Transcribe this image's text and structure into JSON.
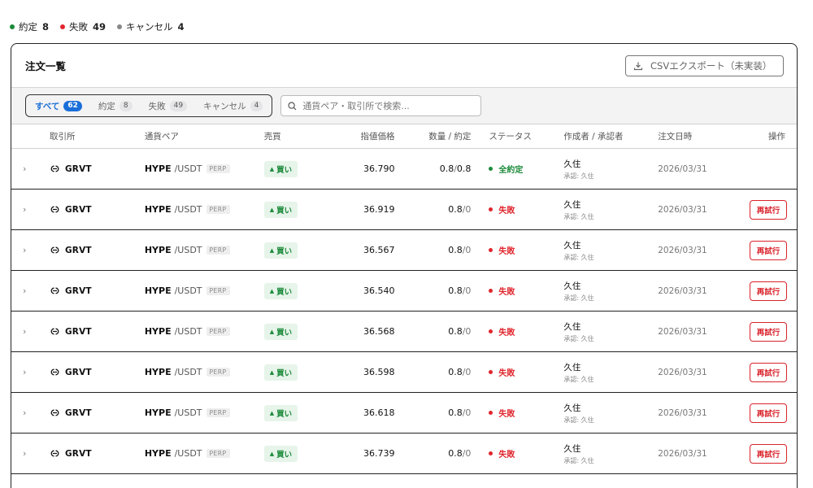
{
  "summary": {
    "filled": {
      "label": "約定",
      "count": "8",
      "color": "#1b8a3a"
    },
    "failed": {
      "label": "失敗",
      "count": "49",
      "color": "#e0262d"
    },
    "canceled": {
      "label": "キャンセル",
      "count": "4",
      "color": "#888888"
    }
  },
  "panel": {
    "title": "注文一覧",
    "export_label": "CSVエクスポート（未実装）",
    "export_icon": "download-icon"
  },
  "filters": {
    "tabs": [
      {
        "label": "すべて",
        "count": "62",
        "active": true
      },
      {
        "label": "約定",
        "count": "8",
        "active": false
      },
      {
        "label": "失敗",
        "count": "49",
        "active": false
      },
      {
        "label": "キャンセル",
        "count": "4",
        "active": false
      }
    ],
    "search_placeholder": "通貨ペア・取引所で検索...",
    "search_icon": "search-icon"
  },
  "table": {
    "columns": [
      "取引所",
      "通貨ペア",
      "売買",
      "指値価格",
      "数量 / 約定",
      "ステータス",
      "作成者 / 承認者",
      "注文日時",
      "操作"
    ],
    "rows": [
      {
        "exchange": "GRVT",
        "base": "HYPE",
        "quote": "/USDT",
        "market": "PERP",
        "side": "買い",
        "price": "36.790",
        "qty": "0.8",
        "filled": "0.8",
        "status": "全約定",
        "status_kind": "ok",
        "creator": "久住",
        "approver": "承認: 久住",
        "date": "2026/03/31",
        "action": ""
      },
      {
        "exchange": "GRVT",
        "base": "HYPE",
        "quote": "/USDT",
        "market": "PERP",
        "side": "買い",
        "price": "36.919",
        "qty": "0.8",
        "filled": "0",
        "status": "失敗",
        "status_kind": "fail",
        "creator": "久住",
        "approver": "承認: 久住",
        "date": "2026/03/31",
        "action": "再試行"
      },
      {
        "exchange": "GRVT",
        "base": "HYPE",
        "quote": "/USDT",
        "market": "PERP",
        "side": "買い",
        "price": "36.567",
        "qty": "0.8",
        "filled": "0",
        "status": "失敗",
        "status_kind": "fail",
        "creator": "久住",
        "approver": "承認: 久住",
        "date": "2026/03/31",
        "action": "再試行"
      },
      {
        "exchange": "GRVT",
        "base": "HYPE",
        "quote": "/USDT",
        "market": "PERP",
        "side": "買い",
        "price": "36.540",
        "qty": "0.8",
        "filled": "0",
        "status": "失敗",
        "status_kind": "fail",
        "creator": "久住",
        "approver": "承認: 久住",
        "date": "2026/03/31",
        "action": "再試行"
      },
      {
        "exchange": "GRVT",
        "base": "HYPE",
        "quote": "/USDT",
        "market": "PERP",
        "side": "買い",
        "price": "36.568",
        "qty": "0.8",
        "filled": "0",
        "status": "失敗",
        "status_kind": "fail",
        "creator": "久住",
        "approver": "承認: 久住",
        "date": "2026/03/31",
        "action": "再試行"
      },
      {
        "exchange": "GRVT",
        "base": "HYPE",
        "quote": "/USDT",
        "market": "PERP",
        "side": "買い",
        "price": "36.598",
        "qty": "0.8",
        "filled": "0",
        "status": "失敗",
        "status_kind": "fail",
        "creator": "久住",
        "approver": "承認: 久住",
        "date": "2026/03/31",
        "action": "再試行"
      },
      {
        "exchange": "GRVT",
        "base": "HYPE",
        "quote": "/USDT",
        "market": "PERP",
        "side": "買い",
        "price": "36.618",
        "qty": "0.8",
        "filled": "0",
        "status": "失敗",
        "status_kind": "fail",
        "creator": "久住",
        "approver": "承認: 久住",
        "date": "2026/03/31",
        "action": "再試行"
      },
      {
        "exchange": "GRVT",
        "base": "HYPE",
        "quote": "/USDT",
        "market": "PERP",
        "side": "買い",
        "price": "36.739",
        "qty": "0.8",
        "filled": "0",
        "status": "失敗",
        "status_kind": "fail",
        "creator": "久住",
        "approver": "承認: 久住",
        "date": "2026/03/31",
        "action": "再試行"
      }
    ]
  },
  "colors": {
    "ok": "#1b8a3a",
    "fail": "#e0262d",
    "accent": "#1a6fd8"
  }
}
